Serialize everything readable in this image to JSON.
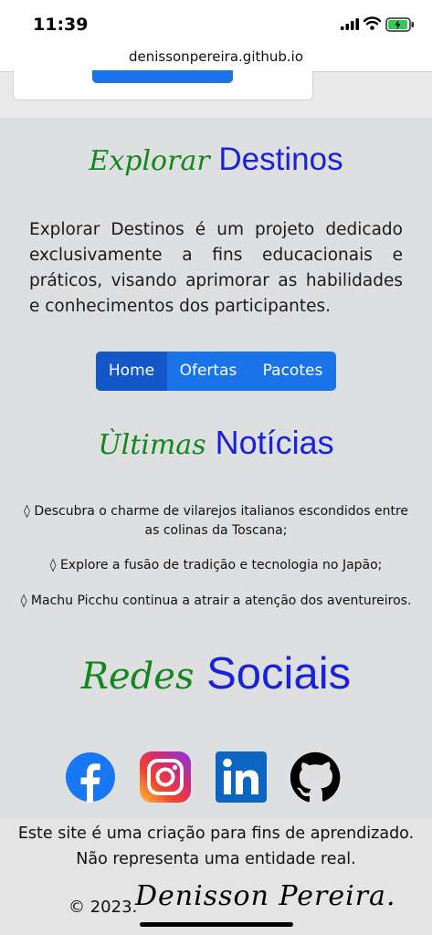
{
  "status_bar": {
    "time": "11:39"
  },
  "browser": {
    "url": "denissonpereira.github.io"
  },
  "destinos": {
    "heading_script": "Explorar",
    "heading_bold": "Destinos"
  },
  "intro": "Explorar Destinos é um projeto dedicado exclusivamente a fins educacionais e práticos, visando aprimorar as habilidades e conhecimentos dos participantes.",
  "nav": {
    "home": "Home",
    "ofertas": "Ofertas",
    "pacotes": "Pacotes"
  },
  "noticias": {
    "heading_script": "Ùltimas",
    "heading_bold": "Notícias",
    "items": [
      "◊ Descubra o charme de vilarejos italianos escondidos entre as colinas da Toscana;",
      "◊ Explore a fusão de tradição e tecnologia no Japão;",
      "◊ Machu Picchu continua a atrair a atenção dos aventureiros."
    ]
  },
  "redes": {
    "heading_script": "Redes",
    "heading_bold": "Sociais",
    "icons": [
      "facebook-icon",
      "instagram-icon",
      "linkedin-icon",
      "github-icon"
    ]
  },
  "footer": {
    "text": "Este site é uma criação para fins de aprendizado. Não representa uma entidade real.",
    "copyright": "© 2023.",
    "signature": "Denisson Pereira."
  },
  "colors": {
    "nav_blue": "#1a73e8",
    "heading_green": "#13871b",
    "heading_blue": "#1a22d8"
  }
}
